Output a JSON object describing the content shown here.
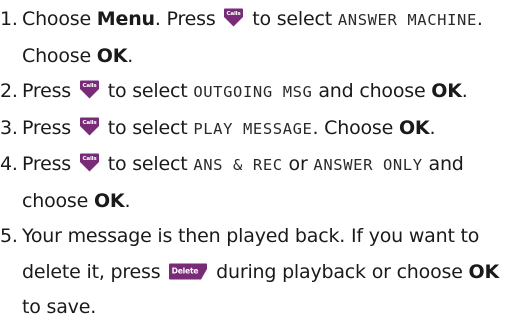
{
  "steps": [
    {
      "number": "1.",
      "parts": [
        {
          "type": "text",
          "value": "Choose "
        },
        {
          "type": "bold",
          "value": "Menu"
        },
        {
          "type": "text",
          "value": ". Press "
        },
        {
          "type": "icon",
          "icon": "calls-key",
          "label": "Calls"
        },
        {
          "type": "text",
          "value": " to select "
        },
        {
          "type": "lcd",
          "value": "ANSWER MACHINE"
        },
        {
          "type": "text",
          "value": ". Choose "
        },
        {
          "type": "bold",
          "value": "OK"
        },
        {
          "type": "text",
          "value": "."
        }
      ]
    },
    {
      "number": "2.",
      "parts": [
        {
          "type": "text",
          "value": "Press "
        },
        {
          "type": "icon",
          "icon": "calls-key",
          "label": "Calls"
        },
        {
          "type": "text",
          "value": " to select "
        },
        {
          "type": "lcd",
          "value": "OUTGOING MSG"
        },
        {
          "type": "text",
          "value": " and choose "
        },
        {
          "type": "bold",
          "value": "OK"
        },
        {
          "type": "text",
          "value": "."
        }
      ]
    },
    {
      "number": "3.",
      "parts": [
        {
          "type": "text",
          "value": "Press "
        },
        {
          "type": "icon",
          "icon": "calls-key",
          "label": "Calls"
        },
        {
          "type": "text",
          "value": " to select "
        },
        {
          "type": "lcd",
          "value": "PLAY MESSAGE"
        },
        {
          "type": "text",
          "value": ". Choose "
        },
        {
          "type": "bold",
          "value": "OK"
        },
        {
          "type": "text",
          "value": "."
        }
      ]
    },
    {
      "number": "4.",
      "parts": [
        {
          "type": "text",
          "value": "Press "
        },
        {
          "type": "icon",
          "icon": "calls-key",
          "label": "Calls"
        },
        {
          "type": "text",
          "value": " to select "
        },
        {
          "type": "lcd",
          "value": "ANS & REC"
        },
        {
          "type": "text",
          "value": " or "
        },
        {
          "type": "lcd",
          "value": "ANSWER ONLY"
        },
        {
          "type": "text",
          "value": " and choose "
        },
        {
          "type": "bold",
          "value": "OK"
        },
        {
          "type": "text",
          "value": "."
        }
      ]
    },
    {
      "number": "5.",
      "parts": [
        {
          "type": "text",
          "value": "Your message is then played back. If you want to delete it, press "
        },
        {
          "type": "icon",
          "icon": "delete-key",
          "label": "Delete"
        },
        {
          "type": "text",
          "value": " during playback or choose "
        },
        {
          "type": "bold",
          "value": "OK"
        },
        {
          "type": "text",
          "value": " to save."
        }
      ]
    }
  ],
  "colors": {
    "text": "#1a1a1a",
    "key_fill": "#7a2b78",
    "key_text": "#ffffff"
  }
}
